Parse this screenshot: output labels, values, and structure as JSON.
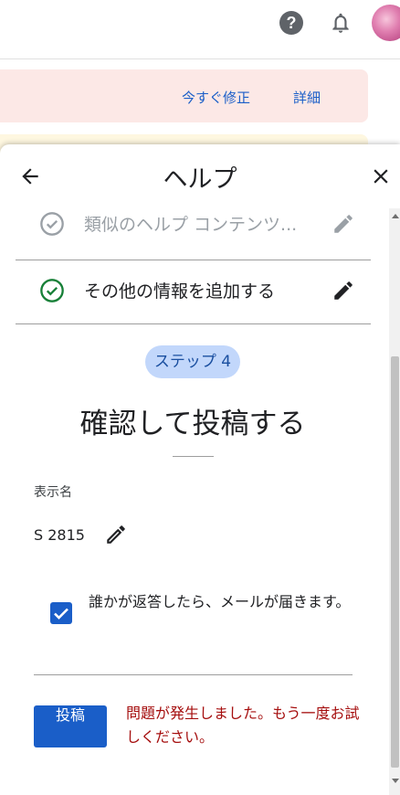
{
  "topbar": {
    "help_icon": "question-circle-icon",
    "help_glyph": "?",
    "notifications_icon": "bell-icon",
    "avatar_icon": "user-avatar"
  },
  "banner": {
    "fix_now_label": "今すぐ修正",
    "details_label": "詳細"
  },
  "panel": {
    "title": "ヘルプ",
    "back_icon": "arrow-left-icon",
    "close_icon": "close-icon",
    "steps": [
      {
        "label": "類似のヘルプ コンテンツ...",
        "state": "done-dimmed",
        "icon": "check-circle-icon",
        "edit_icon": "pencil-icon"
      },
      {
        "label": "その他の情報を追加する",
        "state": "done",
        "icon": "check-circle-icon",
        "edit_icon": "pencil-icon"
      }
    ],
    "step_chip": "ステップ 4",
    "heading": "確認して投稿する",
    "display_name_label": "表示名",
    "display_name_value": "S 2815",
    "notify_checkbox_checked": true,
    "notify_text": "誰かが返答したら、メールが届きます。",
    "post_button": "投稿",
    "error_message": "問題が発生しました。もう一度お試しください。"
  },
  "colors": {
    "accent": "#1a5ec8",
    "success": "#188038",
    "error": "#a50e0e",
    "chip_bg": "#c2d7fb",
    "banner_pink": "#fce8e6",
    "banner_yellow": "#fef7e0"
  }
}
